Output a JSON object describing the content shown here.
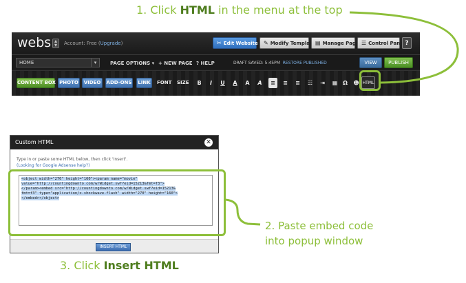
{
  "annotations": {
    "step1_prefix": "1. Click ",
    "step1_bold": "HTML",
    "step1_suffix": " in the menu at the top",
    "step2_line1": "2. Paste embed code",
    "step2_line2": "into popup window",
    "step3_prefix": "3. Click ",
    "step3_bold": "Insert HTML"
  },
  "editor": {
    "logo": "webs",
    "account_label": "Account: Free (",
    "account_upgrade": "Upgrade",
    "account_close": ")",
    "top_buttons": {
      "edit_website": "Edit Website",
      "modify_template": "Modify Template",
      "manage_pages": "Manage Pages",
      "control_panel": "Control Panel"
    },
    "help_glyph": "?",
    "page_select_value": "HOME",
    "page_options": "PAGE OPTIONS ▾",
    "new_page": "+  NEW PAGE",
    "help": "?  HELP",
    "draft_status": "DRAFT SAVED: 5:45PM",
    "restore_published": "RESTORE PUBLISHED",
    "view": "VIEW",
    "publish": "PUBLISH",
    "toolbar": {
      "content_box": "CONTENT BOX",
      "photo": "PHOTO",
      "video": "VIDEO",
      "add_ons": "ADD-ONS",
      "link": "LINK",
      "font": "FONT",
      "size": "SIZE",
      "bold": "B",
      "italic": "I",
      "underline": "U",
      "text_color": "A",
      "bg_color": "A",
      "clear_format": "A",
      "omega": "Ω",
      "html": "HTML"
    }
  },
  "dialog": {
    "title": "Custom HTML",
    "close_glyph": "✕",
    "instructions": "Type in or paste some HTML below, then click 'Insert'.",
    "link_text": "(Looking for Google Adsense help?)",
    "code_lines": [
      "<object width=\"270\" height=\"160\"><param name=\"movie\"",
      "value=\"http://countingdownto.com/w/Widget.swf?eid=15213&fmt=f3\">",
      "</param><embed src=\"http://countingdownto.com/w/Widget.swf?eid=15213&",
      "fmt=f3\" type=\"application/x-shockwave-flash\" width=\"270\" height=\"160\">",
      "</embed></object>"
    ],
    "insert_button": "INSERT HTML"
  },
  "colors": {
    "annotation_green": "#8dbf3a",
    "annotation_dark_green": "#4e7d1e",
    "editor_blue": "#3e70ad",
    "editor_green": "#4d8d25"
  }
}
